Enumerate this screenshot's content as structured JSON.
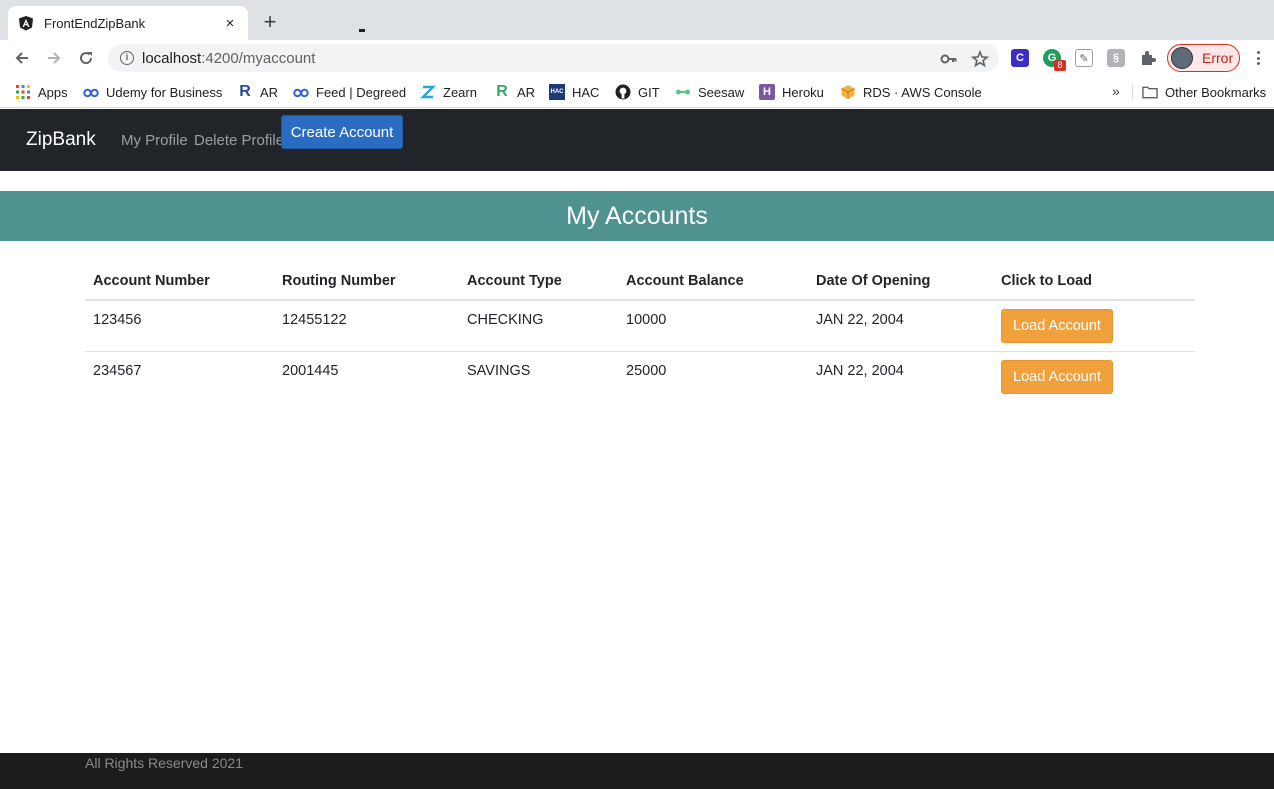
{
  "browser": {
    "tab_title": "FrontEndZipBank",
    "tab_close": "×",
    "new_tab": "+",
    "url_host": "localhost",
    "url_path": ":4200/myaccount",
    "profile_label": "Error",
    "extension_badge": "8",
    "bookmarks_overflow": "»"
  },
  "bookmarks": [
    {
      "label": "Apps",
      "icon": "apps-grid-icon"
    },
    {
      "label": "Udemy for Business",
      "icon": "udemy-icon"
    },
    {
      "label": "AR",
      "icon": "ar-icon"
    },
    {
      "label": "Feed | Degreed",
      "icon": "degreed-icon"
    },
    {
      "label": "Zearn",
      "icon": "zearn-icon"
    },
    {
      "label": "AR",
      "icon": "ar-icon"
    },
    {
      "label": "HAC",
      "icon": "hac-icon"
    },
    {
      "label": "GIT",
      "icon": "github-icon"
    },
    {
      "label": "Seesaw",
      "icon": "seesaw-icon"
    },
    {
      "label": "Heroku",
      "icon": "heroku-icon"
    },
    {
      "label": "RDS · AWS Console",
      "icon": "aws-icon"
    },
    {
      "label": "Other Bookmarks",
      "icon": "folder-icon"
    }
  ],
  "navbar": {
    "brand": "ZipBank",
    "links": [
      "My Profile",
      "Delete Profile"
    ],
    "create_button": "Create Account"
  },
  "page": {
    "title": "My Accounts"
  },
  "table": {
    "headers": [
      "Account Number",
      "Routing Number",
      "Account Type",
      "Account Balance",
      "Date Of Opening",
      "Click to Load"
    ],
    "rows": [
      {
        "account_number": "123456",
        "routing_number": "12455122",
        "account_type": "CHECKING",
        "balance": "10000",
        "date_opened": "JAN 22, 2004",
        "action": "Load Account"
      },
      {
        "account_number": "234567",
        "routing_number": "2001445",
        "account_type": "SAVINGS",
        "balance": "25000",
        "date_opened": "JAN 22, 2004",
        "action": "Load Account"
      }
    ]
  },
  "footer": {
    "text": "All Rights Reserved 2021"
  },
  "colors": {
    "navbar_bg": "#212529",
    "banner_bg": "#4f9290",
    "primary_button": "#2a6cc2",
    "warning_button": "#f0a13c",
    "footer_bg": "#1c1c1c"
  }
}
